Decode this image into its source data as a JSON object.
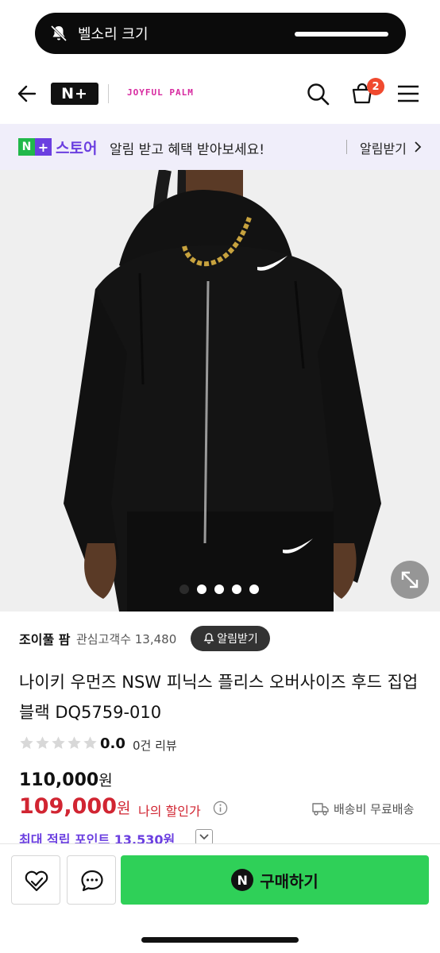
{
  "toast": {
    "label": "벨소리 크기",
    "icon": "bell-slash-icon"
  },
  "header": {
    "logo": "N+",
    "store_logo": "JOYFUL PALM",
    "cart_count": "2",
    "icons": [
      "back-arrow-icon",
      "search-icon",
      "cart-icon",
      "menu-icon"
    ]
  },
  "notice": {
    "badge_n": "N",
    "badge_plus": "+",
    "store_word": "스토어",
    "message": "알림 받고 혜택 받아보세요!",
    "action": "알림받기"
  },
  "carousel": {
    "total": 5,
    "active_index": 0
  },
  "product": {
    "seller": "조이풀 팜",
    "followers": "관심고객수 13,480",
    "follow_label": "알림받기",
    "title": "나이키 우먼즈 NSW 피닉스 플리스 오버사이즈 후드 집업 블랙 DQ5759-010",
    "rating": "0.0",
    "reviews": "0건 리뷰",
    "price": "110,000",
    "price_unit": "원",
    "sale_price": "109,000",
    "sale_unit": "원",
    "my_discount": "나의 할인가",
    "shipping": "배송비 무료배송",
    "points": "최대 적립 포인트 13,530원"
  },
  "bottom": {
    "buy_badge": "N",
    "buy_label": "구매하기"
  },
  "colors": {
    "accent_purple": "#6b3fe0",
    "sale_red": "#d12532",
    "buy_green": "#2fd058",
    "badge_orange": "#f04a2f"
  }
}
